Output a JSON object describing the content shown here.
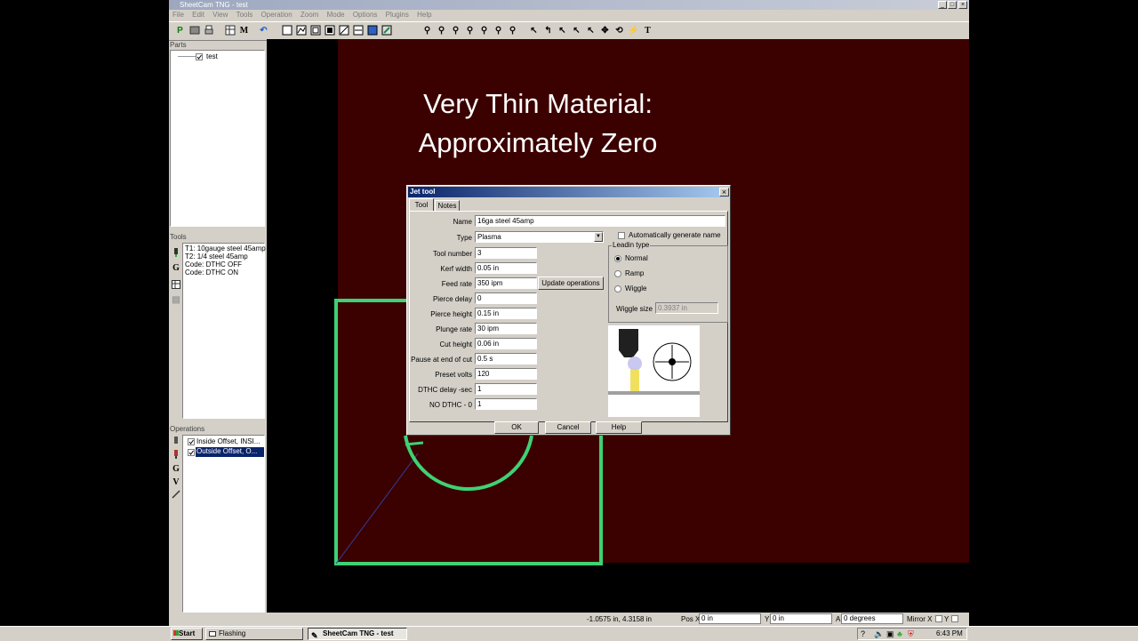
{
  "window": {
    "title": "SheetCam TNG - test",
    "controls": {
      "minimize": "_",
      "maximize": "□",
      "close": "×"
    }
  },
  "menu": [
    "File",
    "Edit",
    "View",
    "Tools",
    "Operation",
    "Zoom",
    "Mode",
    "Options",
    "Plugins",
    "Help"
  ],
  "toolbar": {
    "icons": [
      "process-icon",
      "machine-icon",
      "print-icon",
      "table-icon",
      "undo-icon",
      "select-icon",
      "line-icon",
      "rect-icon",
      "circle-icon",
      "cut-icon",
      "view-icon",
      "view2-icon",
      "zoom-icon"
    ],
    "text_buttons": [
      "P",
      "M",
      "T"
    ]
  },
  "parts": {
    "label": "Parts",
    "items": [
      {
        "name": "test",
        "checked": true
      }
    ]
  },
  "tools": {
    "label": "Tools",
    "items": [
      "T1: 10gauge steel 45amp",
      "T2: 1/4 steel 45amp",
      "Code: DTHC OFF",
      "Code: DTHC ON"
    ],
    "side_buttons": [
      "G"
    ]
  },
  "operations": {
    "label": "Operations",
    "items": [
      {
        "name": "Inside Offset, INSI...",
        "checked": true,
        "selected": false
      },
      {
        "name": "Outside Offset, O...",
        "checked": true,
        "selected": true
      }
    ],
    "side_buttons": [
      "G",
      "V"
    ]
  },
  "overlay_text": [
    "Very Thin Material:",
    "Approximately Zero"
  ],
  "dialog": {
    "title": "Jet tool",
    "close": "×",
    "tabs": [
      "Tool",
      "Notes"
    ],
    "active_tab": "Tool",
    "name": {
      "label": "Name",
      "value": "16ga steel 45amp"
    },
    "type": {
      "label": "Type",
      "value": "Plasma"
    },
    "fields": [
      {
        "label": "Tool number",
        "value": "3"
      },
      {
        "label": "Kerf width",
        "value": "0.05 in"
      },
      {
        "label": "Feed rate",
        "value": "350 ipm"
      },
      {
        "label": "Pierce delay",
        "value": "0"
      },
      {
        "label": "Pierce height",
        "value": "0.15 in"
      },
      {
        "label": "Plunge rate",
        "value": "30 ipm"
      },
      {
        "label": "Cut height",
        "value": "0.06 in"
      },
      {
        "label": "Pause at end of cut",
        "value": "0.5 s"
      },
      {
        "label": "Preset volts",
        "value": "120"
      },
      {
        "label": "DTHC delay -sec",
        "value": "1"
      },
      {
        "label": "NO DTHC - 0",
        "value": "1"
      }
    ],
    "update_button": "Update operations",
    "auto_name": {
      "label": "Automatically generate name",
      "checked": false
    },
    "leadin": {
      "group_label": "Leadin type",
      "options": [
        "Normal",
        "Ramp",
        "Wiggle"
      ],
      "selected": "Normal",
      "wiggle_label": "Wiggle size",
      "wiggle_value": "0.3937 in"
    },
    "buttons": [
      "OK",
      "Cancel",
      "Help"
    ]
  },
  "status": {
    "coords": "-1.0575 in, 4.3158 in",
    "pos_x_label": "Pos X",
    "pos_x": "0 in",
    "y_label": "Y",
    "y": "0 in",
    "a_label": "A",
    "a": "0 degrees",
    "mirror_x_label": "Mirror X",
    "mirror_y_label": "Y"
  },
  "taskbar": {
    "start": "Start",
    "tasks": [
      "Flashing",
      "SheetCam TNG - test"
    ],
    "time": "6:43 PM"
  }
}
